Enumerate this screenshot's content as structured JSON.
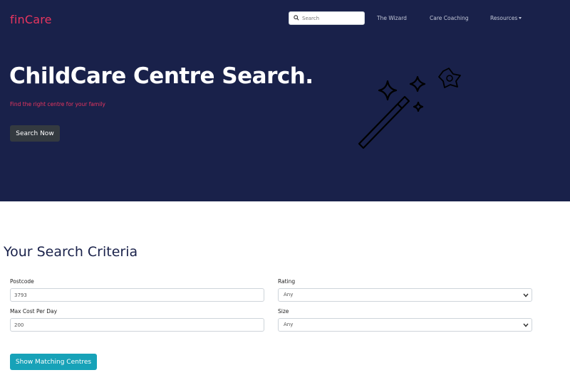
{
  "nav": {
    "brand": "finCare",
    "search_placeholder": "Search",
    "links": [
      "The Wizard",
      "Care Coaching",
      "Resources"
    ]
  },
  "hero": {
    "title": "ChildCare Centre Search.",
    "subtitle": "Find the right centre for your family",
    "cta_label": "Search Now",
    "illustration_icon": "magic-wand-icon"
  },
  "criteria": {
    "title": "Your Search Criteria",
    "postcode_label": "Postcode",
    "postcode_value": "3793",
    "rating_label": "Rating",
    "rating_value": "Any",
    "cost_label": "Max Cost Per Day",
    "cost_value": "200",
    "size_label": "Size",
    "size_value": "Any",
    "submit_label": "Show Matching Centres"
  },
  "colors": {
    "hero_bg": "#19214a",
    "brand": "#e8355f",
    "teal_button": "#17a2b8",
    "dark_button": "#343a40"
  }
}
